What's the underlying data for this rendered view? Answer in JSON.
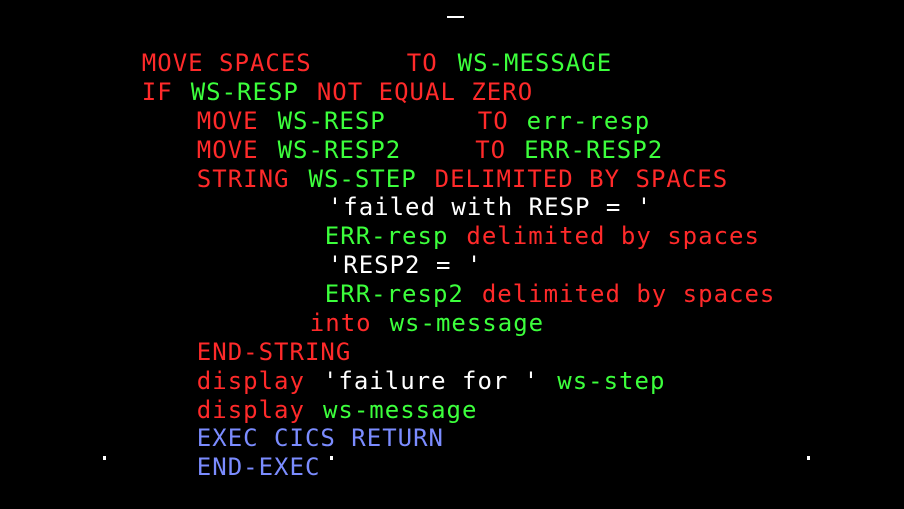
{
  "terminal": {
    "cursor_marker": "_",
    "lines": [
      {
        "tokens": [
          {
            "text": "MOVE SPACES",
            "color": "red"
          },
          {
            "text": "TO",
            "color": "red"
          },
          {
            "text": "WS-MESSAGE",
            "color": "green"
          }
        ]
      },
      {
        "tokens": [
          {
            "text": "IF",
            "color": "red"
          },
          {
            "text": "WS-RESP",
            "color": "green"
          },
          {
            "text": "NOT EQUAL ZERO",
            "color": "red"
          }
        ]
      },
      {
        "tokens": [
          {
            "text": "MOVE",
            "color": "red"
          },
          {
            "text": "WS-RESP",
            "color": "green"
          },
          {
            "text": "TO",
            "color": "red"
          },
          {
            "text": "err-resp",
            "color": "green"
          }
        ]
      },
      {
        "tokens": [
          {
            "text": "MOVE",
            "color": "red"
          },
          {
            "text": "WS-RESP2",
            "color": "green"
          },
          {
            "text": "TO",
            "color": "red"
          },
          {
            "text": "ERR-RESP2",
            "color": "green"
          }
        ]
      },
      {
        "tokens": [
          {
            "text": "STRING",
            "color": "red"
          },
          {
            "text": "WS-STEP",
            "color": "green"
          },
          {
            "text": "DELIMITED BY SPACES",
            "color": "red"
          }
        ]
      },
      {
        "tokens": [
          {
            "text": "'failed with RESP = '",
            "color": "white"
          }
        ]
      },
      {
        "tokens": [
          {
            "text": "ERR-resp",
            "color": "green"
          },
          {
            "text": "delimited by spaces",
            "color": "red"
          }
        ]
      },
      {
        "tokens": [
          {
            "text": "'RESP2 = '",
            "color": "white"
          }
        ]
      },
      {
        "tokens": [
          {
            "text": "ERR-resp2",
            "color": "green"
          },
          {
            "text": "delimited by spaces",
            "color": "red"
          }
        ]
      },
      {
        "tokens": [
          {
            "text": "into",
            "color": "red"
          },
          {
            "text": "ws-message",
            "color": "green"
          }
        ]
      },
      {
        "tokens": [
          {
            "text": "END-STRING",
            "color": "red"
          }
        ]
      },
      {
        "tokens": [
          {
            "text": "display",
            "color": "red"
          },
          {
            "text": "'failure for '",
            "color": "white"
          },
          {
            "text": "ws-step",
            "color": "green"
          }
        ]
      },
      {
        "tokens": [
          {
            "text": "display",
            "color": "red"
          },
          {
            "text": "ws-message",
            "color": "green"
          }
        ]
      },
      {
        "tokens": [
          {
            "text": "EXEC CICS RETURN",
            "color": "blue"
          }
        ]
      },
      {
        "tokens": [
          {
            "text": "END-EXEC",
            "color": "blue"
          }
        ]
      }
    ]
  }
}
